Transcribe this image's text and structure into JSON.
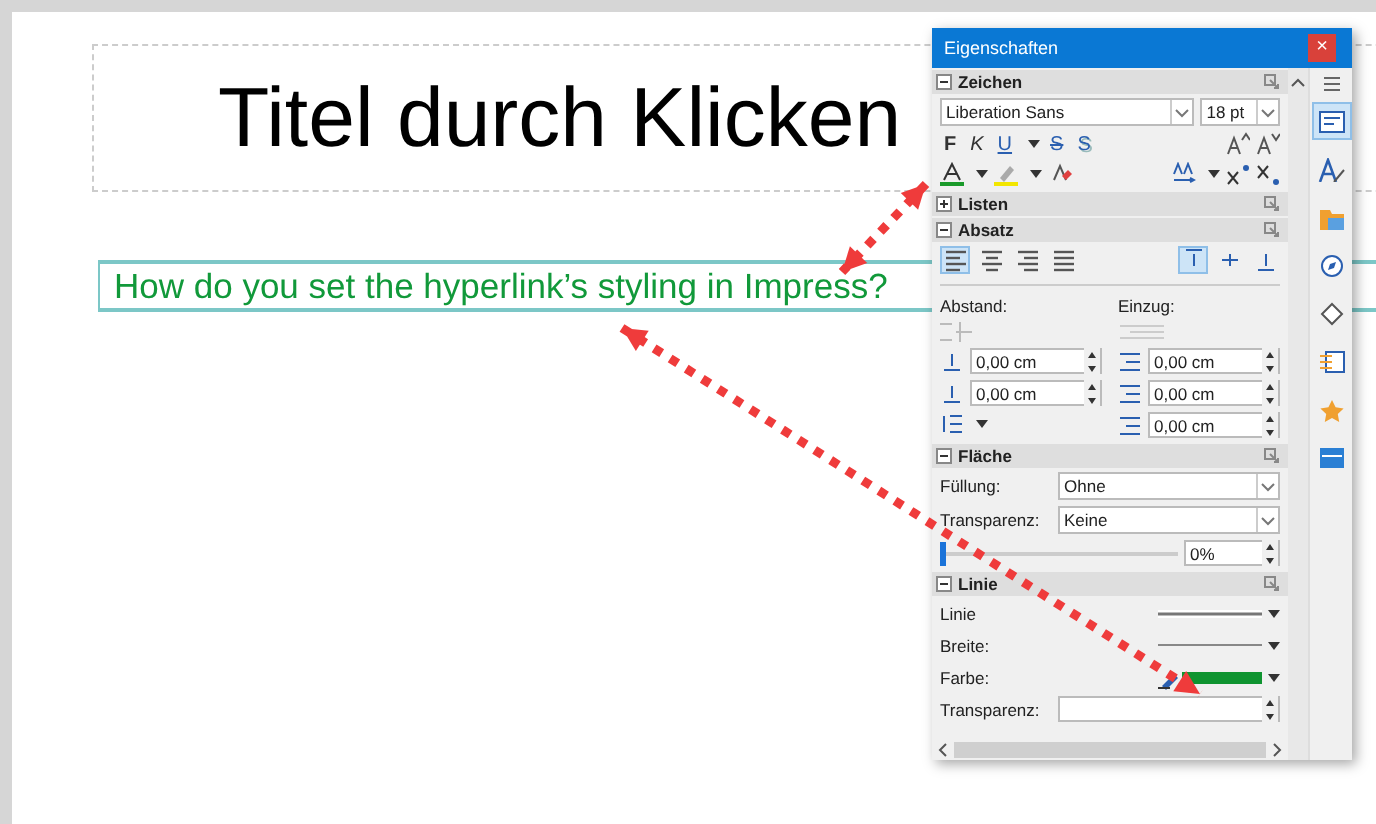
{
  "slide": {
    "title": "Titel durch Klicken",
    "text": "How do you set the hyperlink’s styling in Impress?"
  },
  "panel": {
    "title": "Eigenschaften",
    "close": "×",
    "sections": [
      {
        "kind": "zeichen",
        "title": "Zeichen",
        "expanded": true,
        "font": "Liberation Sans",
        "size": "18 pt",
        "formats": [
          {
            "label": "F",
            "kind": "bold"
          },
          {
            "label": "K",
            "kind": "italic"
          },
          {
            "label": "U",
            "kind": "underline"
          },
          {
            "label": "S",
            "kind": "strike"
          },
          {
            "label": "S",
            "kind": "shadow"
          }
        ]
      },
      {
        "title": "Listen",
        "expanded": false
      },
      {
        "kind": "absatz",
        "title": "Absatz",
        "expanded": true,
        "align": [
          {
            "kind": "left",
            "selected": true
          },
          {
            "kind": "center",
            "selected": false
          },
          {
            "kind": "right",
            "selected": false
          },
          {
            "kind": "justify",
            "selected": false
          }
        ],
        "valign": [
          {
            "kind": "top",
            "selected": true
          },
          {
            "kind": "middle",
            "selected": false
          },
          {
            "kind": "bottom",
            "selected": false
          }
        ],
        "spacing_label": "Abstand:",
        "indent_label": "Einzug:",
        "spacing": [
          "0,00 cm",
          "0,00 cm"
        ],
        "indent": [
          "0,00 cm",
          "0,00 cm",
          "0,00 cm"
        ]
      },
      {
        "kind": "flaeche",
        "title": "Fläche",
        "expanded": true,
        "fill_label": "Füllung:",
        "fill": "Ohne",
        "transparency_label": "Transparenz:",
        "transparency": "Keine",
        "level": 0,
        "percent": "0%"
      },
      {
        "kind": "linie",
        "title": "Linie",
        "expanded": true,
        "line_label": "Linie",
        "width_label": "Breite:",
        "color_label": "Farbe:",
        "color": "#0f9430",
        "transparency_label": "Transparenz:"
      }
    ],
    "tabs": [
      {
        "kind": "properties",
        "selected": true
      },
      {
        "kind": "styles",
        "selected": false
      },
      {
        "kind": "gallery",
        "selected": false
      },
      {
        "kind": "navigator",
        "selected": false
      },
      {
        "kind": "shapes",
        "selected": false
      },
      {
        "kind": "transition",
        "selected": false
      },
      {
        "kind": "animation",
        "selected": false
      },
      {
        "kind": "master",
        "selected": false
      }
    ]
  }
}
